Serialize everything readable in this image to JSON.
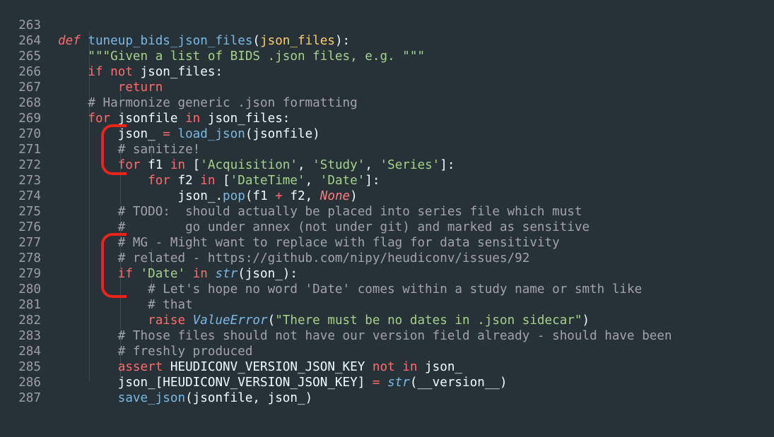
{
  "editor": {
    "lines": [
      {
        "num": "263"
      },
      {
        "num": "264"
      },
      {
        "num": "265"
      },
      {
        "num": "266"
      },
      {
        "num": "267"
      },
      {
        "num": "268"
      },
      {
        "num": "269"
      },
      {
        "num": "270"
      },
      {
        "num": "271"
      },
      {
        "num": "272"
      },
      {
        "num": "273"
      },
      {
        "num": "274"
      },
      {
        "num": "275"
      },
      {
        "num": "276"
      },
      {
        "num": "277"
      },
      {
        "num": "278"
      },
      {
        "num": "279"
      },
      {
        "num": "280"
      },
      {
        "num": "281"
      },
      {
        "num": "282"
      },
      {
        "num": "283"
      },
      {
        "num": "284"
      },
      {
        "num": "285"
      },
      {
        "num": "286"
      },
      {
        "num": "287"
      }
    ],
    "tokens": {
      "l263": [
        "def",
        " ",
        "tuneup_bids_json_files",
        "(",
        "json_files",
        "):"
      ],
      "l264": [
        "    ",
        "\"\"\"Given a list of BIDS .json files, e.g. \"\"\""
      ],
      "l265": [
        "    ",
        "if",
        " ",
        "not",
        " json_files:"
      ],
      "l266": [
        "        ",
        "return"
      ],
      "l267": [
        "    ",
        "# Harmonize generic .json formatting"
      ],
      "l268": [
        "    ",
        "for",
        " jsonfile ",
        "in",
        " json_files:"
      ],
      "l269": [
        "        json_ ",
        "=",
        " ",
        "load_json",
        "(jsonfile)"
      ],
      "l270": [
        "        ",
        "# sanitize!"
      ],
      "l271": [
        "        ",
        "for",
        " f1 ",
        "in",
        " [",
        "'Acquisition'",
        ", ",
        "'Study'",
        ", ",
        "'Series'",
        "]:"
      ],
      "l272": [
        "            ",
        "for",
        " f2 ",
        "in",
        " [",
        "'DateTime'",
        ", ",
        "'Date'",
        "]:"
      ],
      "l273": [
        "                json_.",
        "pop",
        "(f1 ",
        "+",
        " f2, ",
        "None",
        ")"
      ],
      "l274": [
        "        ",
        "# TODO:  should actually be placed into series file which must"
      ],
      "l275": [
        "        ",
        "#        go under annex (not under git) and marked as sensitive"
      ],
      "l276": [
        "        ",
        "# MG - Might want to replace with flag for data sensitivity"
      ],
      "l277": [
        "        ",
        "# related - https://github.com/nipy/heudiconv/issues/92"
      ],
      "l278": [
        "        ",
        "if",
        " ",
        "'Date'",
        " ",
        "in",
        " ",
        "str",
        "(json_):"
      ],
      "l279": [
        "            ",
        "# Let's hope no word 'Date' comes within a study name or smth like"
      ],
      "l280": [
        "            ",
        "# that"
      ],
      "l281": [
        "            ",
        "raise",
        " ",
        "ValueError",
        "(",
        "\"There must be no dates in .json sidecar\"",
        ")"
      ],
      "l282": [
        "        ",
        "# Those files should not have our version field already - should have been"
      ],
      "l283": [
        "        ",
        "# freshly produced"
      ],
      "l284": [
        "        ",
        "assert",
        " HEUDICONV_VERSION_JSON_KEY ",
        "not",
        " ",
        "in",
        " json_"
      ],
      "l285": [
        "        json_[HEUDICONV_VERSION_JSON_KEY] ",
        "=",
        " ",
        "str",
        "(__version__)"
      ],
      "l286": [
        "        ",
        "save_json",
        "(jsonfile, json_)"
      ],
      "l287": [
        ""
      ]
    }
  },
  "colors": {
    "background": "#263238",
    "keyword": "#ff6b6b",
    "function": "#7ab8e6",
    "string": "#a6d189",
    "comment": "#a0a4a8",
    "param": "#ffcb6b",
    "annotation_bracket": "#e8251a"
  }
}
